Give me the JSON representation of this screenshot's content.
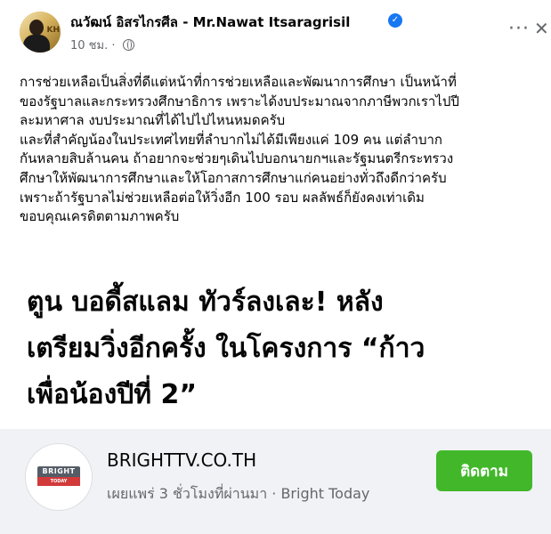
{
  "post": {
    "author": "ณวัฒน์ อิสรไกรศีล - Mr.Nawat Itsaragrisil",
    "time": "10 ชม.",
    "avatar_text": "KH",
    "lines": [
      "การช่วยเหลือเป็นสิ่งที่ดีแต่หน้าที่การช่วยเหลือและพัฒนาการศึกษา เป็นหน้าที่",
      "ของรัฐบาลและกระทรวงศึกษาธิการ เพราะได้งบประมาณจากภาษีพวกเราไปปี",
      "ละมหาศาล งบประมาณที่ได้ไปไปไหนหมดครับ",
      "และที่สำคัญน้องในประเทศไทยที่ลำบากไม่ได้มีเพียงแค่ 109 คน แต่ลำบาก",
      "กันหลายสิบล้านคน ถ้าอยากจะช่วยๆเดินไปบอกนายกฯและรัฐมนตรีกระทรวง",
      "ศึกษาให้พัฒนาการศึกษาและให้โอกาสการศึกษาแก่คนอย่างทั่วถึงดีกว่าครับ",
      "เพราะถ้ารัฐบาลไม่ช่วยเหลือต่อให้วิ่งอีก 100 รอบ ผลลัพธ์ก็ยังคงเท่าเดิม",
      "ขอบคุณเครดิตตามภาพครับ"
    ]
  },
  "link": {
    "headline_lines": [
      "ตูน บอดี้สแลม ทัวร์ลงเละ! หลัง",
      "เตรียมวิ่งอีกครั้ง ในโครงการ “ก้าว",
      "เพื่อน้องปีที่ 2”"
    ],
    "domain": "BRIGHTTV.CO.TH",
    "subline": "เผยแพร่ 3 ชั่วโมงที่ผ่านมา · Bright Today",
    "follow_label": "ติดตาม",
    "logo_top": "BRIGHT",
    "logo_bottom": "TODAY"
  },
  "colors": {
    "verified": "#1877f2",
    "follow_button": "#42b72a",
    "secondary_text": "#65676b"
  },
  "icons": [
    "verified-badge-icon",
    "globe-icon",
    "more-options-icon",
    "close-icon"
  ]
}
